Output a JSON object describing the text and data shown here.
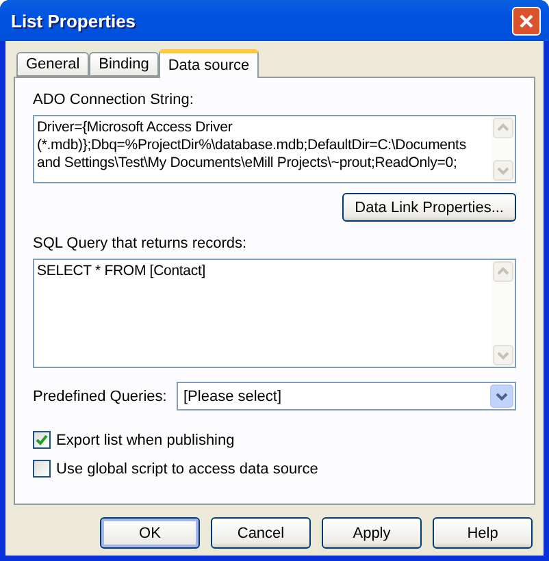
{
  "window": {
    "title": "List Properties"
  },
  "tabs": [
    {
      "label": "General",
      "selected": false
    },
    {
      "label": "Binding",
      "selected": false
    },
    {
      "label": "Data source",
      "selected": true
    }
  ],
  "connection": {
    "label": "ADO Connection String:",
    "lines": [
      "Driver={Microsoft Access Driver",
      "(*.mdb)};Dbq=%ProjectDir%\\database.mdb;DefaultDir=C:\\Documents",
      "and Settings\\Test\\My Documents\\eMill Projects\\~prout;ReadOnly=0;"
    ]
  },
  "data_link_button": "Data Link Properties...",
  "query": {
    "label": "SQL Query that returns records:",
    "value": "SELECT * FROM [Contact]"
  },
  "predefined": {
    "label": "Predefined Queries:",
    "value": "[Please select]"
  },
  "options": [
    {
      "label": "Export list when publishing",
      "checked": true
    },
    {
      "label": "Use global script to access data source",
      "checked": false
    }
  ],
  "buttons": [
    {
      "label": "OK",
      "default": true
    },
    {
      "label": "Cancel",
      "default": false
    },
    {
      "label": "Apply",
      "default": false
    },
    {
      "label": "Help",
      "default": false
    }
  ]
}
